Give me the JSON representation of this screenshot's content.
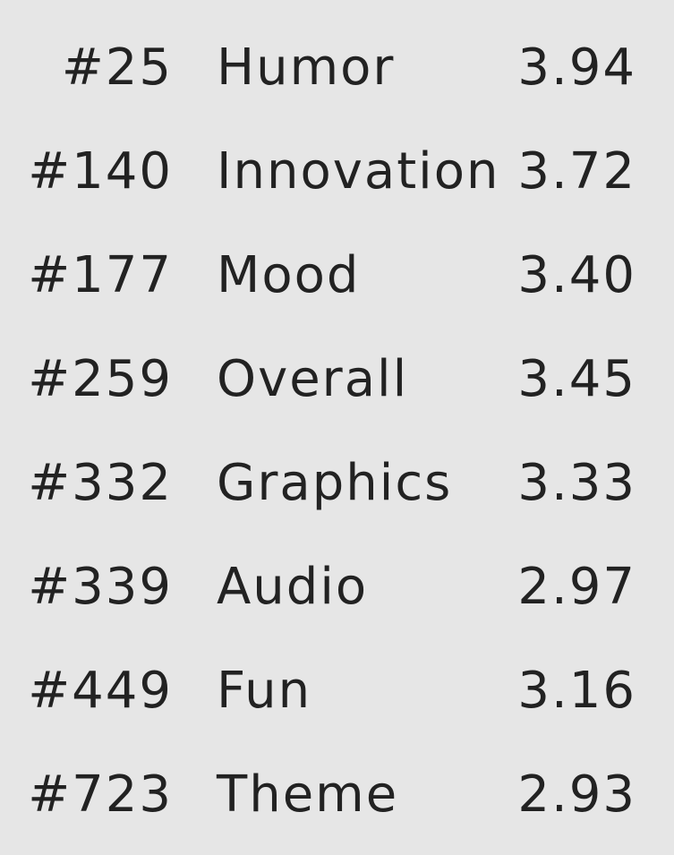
{
  "ratings": [
    {
      "rank": "#25",
      "category": "Humor",
      "score": "3.94"
    },
    {
      "rank": "#140",
      "category": "Innovation",
      "score": "3.72"
    },
    {
      "rank": "#177",
      "category": "Mood",
      "score": "3.40"
    },
    {
      "rank": "#259",
      "category": "Overall",
      "score": "3.45"
    },
    {
      "rank": "#332",
      "category": "Graphics",
      "score": "3.33"
    },
    {
      "rank": "#339",
      "category": "Audio",
      "score": "2.97"
    },
    {
      "rank": "#449",
      "category": "Fun",
      "score": "3.16"
    },
    {
      "rank": "#723",
      "category": "Theme",
      "score": "2.93"
    }
  ],
  "colors": {
    "background": "#e6e6e6",
    "text": "#222222"
  }
}
